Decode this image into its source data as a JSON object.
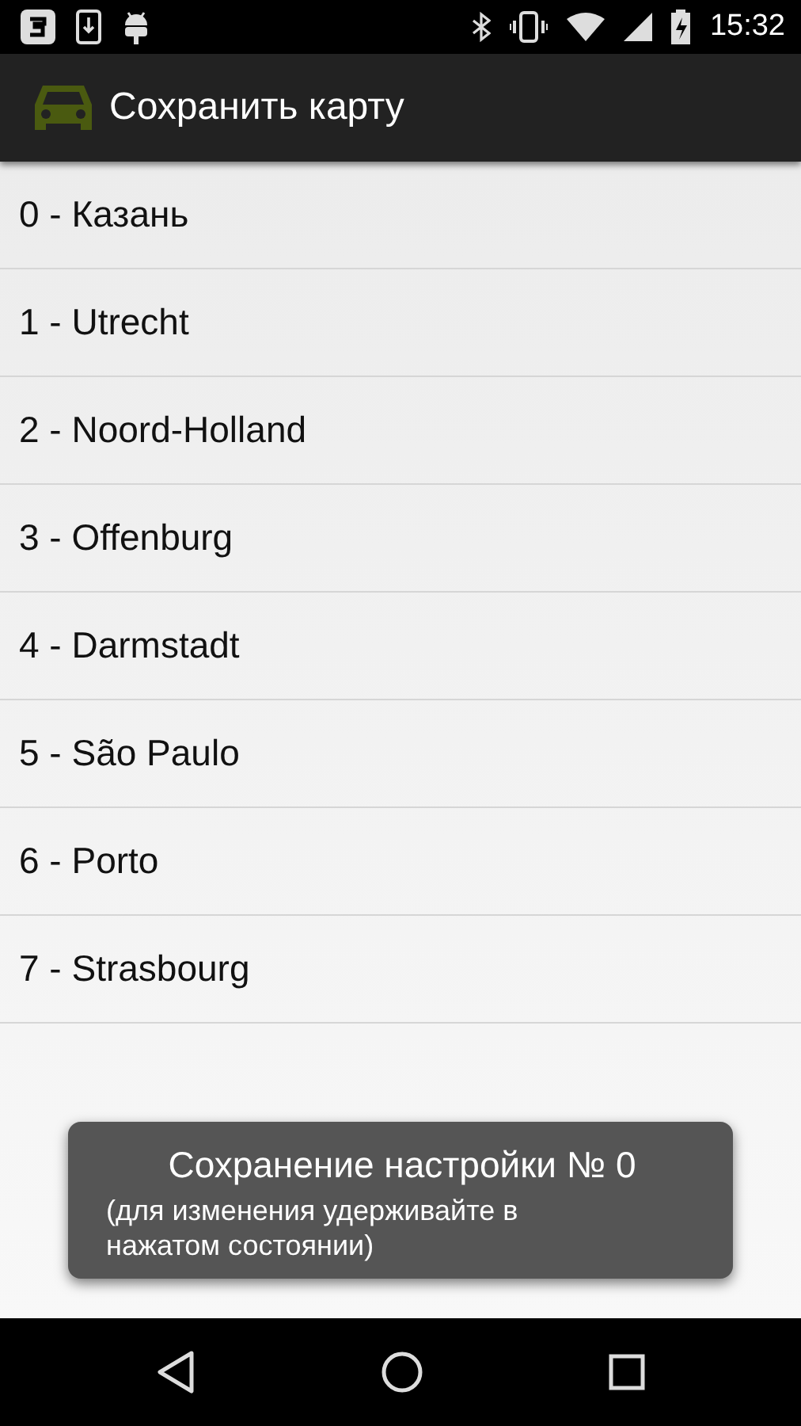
{
  "status_bar": {
    "time": "15:32"
  },
  "app_bar": {
    "title": "Сохранить карту"
  },
  "list": {
    "items": [
      {
        "label": "0 - Казань"
      },
      {
        "label": "1 - Utrecht"
      },
      {
        "label": "2 - Noord-Holland"
      },
      {
        "label": "3 - Offenburg"
      },
      {
        "label": "4 - Darmstadt"
      },
      {
        "label": "5 - São Paulo"
      },
      {
        "label": "6 - Porto"
      },
      {
        "label": "7 - Strasbourg"
      }
    ]
  },
  "toast": {
    "title": "Сохранение настройки № 0",
    "message": "(для изменения удерживайте в нажатом состоянии)"
  }
}
